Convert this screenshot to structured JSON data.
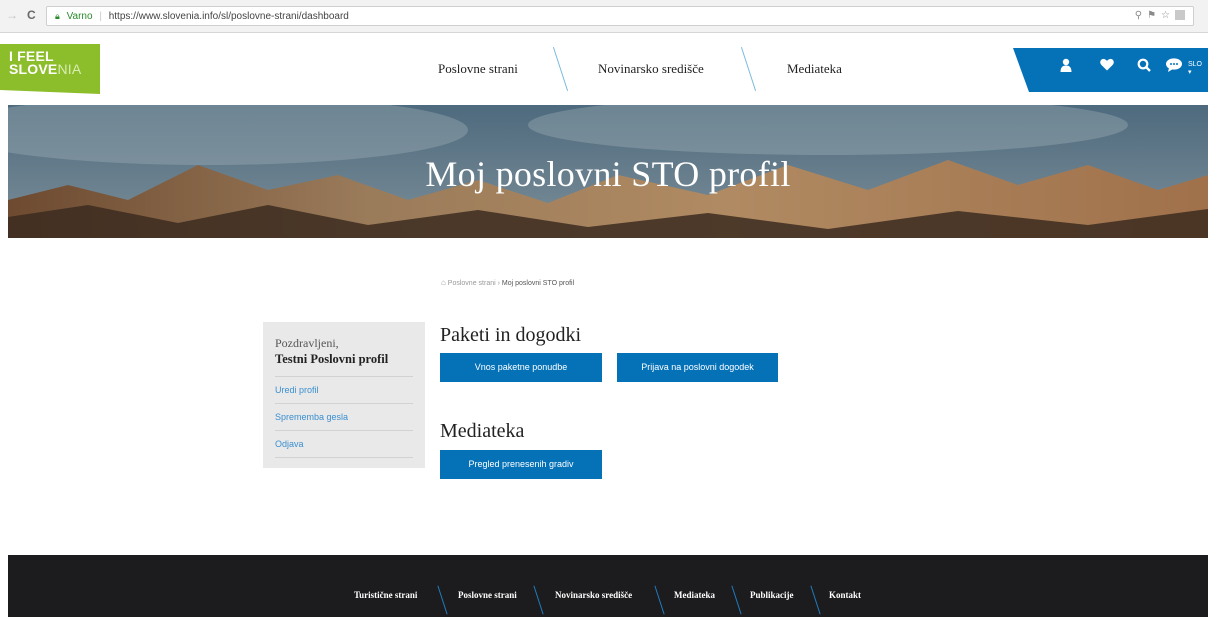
{
  "browser": {
    "secure_label": "Varno",
    "url": "https://www.slovenia.info/sl/poslovne-strani/dashboard"
  },
  "logo": {
    "line1": "I FEEL",
    "line2_bold": "SLOVE",
    "line2_light": "NIA"
  },
  "nav": {
    "items": [
      {
        "label": "Poslovne strani"
      },
      {
        "label": "Novinarsko središče"
      },
      {
        "label": "Mediateka"
      }
    ]
  },
  "userbar": {
    "lang": "SLO"
  },
  "hero": {
    "title": "Moj poslovni STO profil"
  },
  "breadcrumb": {
    "home": "Poslovne strani",
    "separator": "›",
    "current": "Moj poslovni STO profil"
  },
  "sidebar": {
    "greeting": "Pozdravljeni,",
    "profile_name": "Testni Poslovni profil",
    "links": [
      {
        "label": "Uredi profil"
      },
      {
        "label": "Sprememba gesla"
      },
      {
        "label": "Odjava"
      }
    ]
  },
  "sections": {
    "packages": {
      "title": "Paketi in dogodki",
      "btn_package": "Vnos paketne ponudbe",
      "btn_event": "Prijava na poslovni dogodek"
    },
    "media": {
      "title": "Mediateka",
      "btn_review": "Pregled prenesenih gradiv"
    }
  },
  "footer": {
    "links": [
      {
        "label": "Turistične strani"
      },
      {
        "label": "Poslovne strani"
      },
      {
        "label": "Novinarsko središče"
      },
      {
        "label": "Mediateka"
      },
      {
        "label": "Publikacije"
      },
      {
        "label": "Kontakt"
      }
    ]
  },
  "colors": {
    "brand_green": "#8cbd2a",
    "brand_blue": "#0572b8",
    "link_blue": "#3a8fd0",
    "footer_bg": "#1c1b1d"
  }
}
